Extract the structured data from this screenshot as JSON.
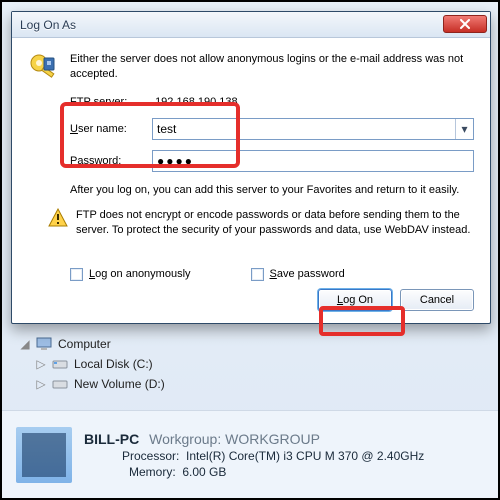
{
  "dialog": {
    "title": "Log On As",
    "message": "Either the server does not allow anonymous logins or the e-mail address was not accepted.",
    "ftp_label": "FTP server:",
    "ftp_value": "192.168.190.138",
    "username_label_pre": "U",
    "username_label_post": "ser name:",
    "username_value": "test",
    "password_label_pre": "P",
    "password_label_post": "assword:",
    "password_value": "●●●●",
    "after_note": "After you log on, you can add this server to your Favorites and return to it easily.",
    "warning": "FTP does not encrypt or encode passwords or data before sending them to the server.  To protect the security of your passwords and data, use WebDAV instead.",
    "cb_anon_pre": "L",
    "cb_anon_post": "og on anonymously",
    "cb_save_pre": "S",
    "cb_save_post": "ave password",
    "btn_logon_pre": "L",
    "btn_logon_post": "og On",
    "btn_cancel": "Cancel"
  },
  "bg": {
    "tree": {
      "computer": "Computer",
      "local": "Local Disk (C:)",
      "vol": "New Volume (D:)"
    },
    "footer": {
      "hostname": "BILL-PC",
      "workgroup_label": "Workgroup:",
      "workgroup": "WORKGROUP",
      "proc_label": "Processor:",
      "proc": "Intel(R) Core(TM) i3 CPU       M 370  @ 2.40GHz",
      "mem_label": "Memory:",
      "mem": "6.00 GB"
    }
  }
}
